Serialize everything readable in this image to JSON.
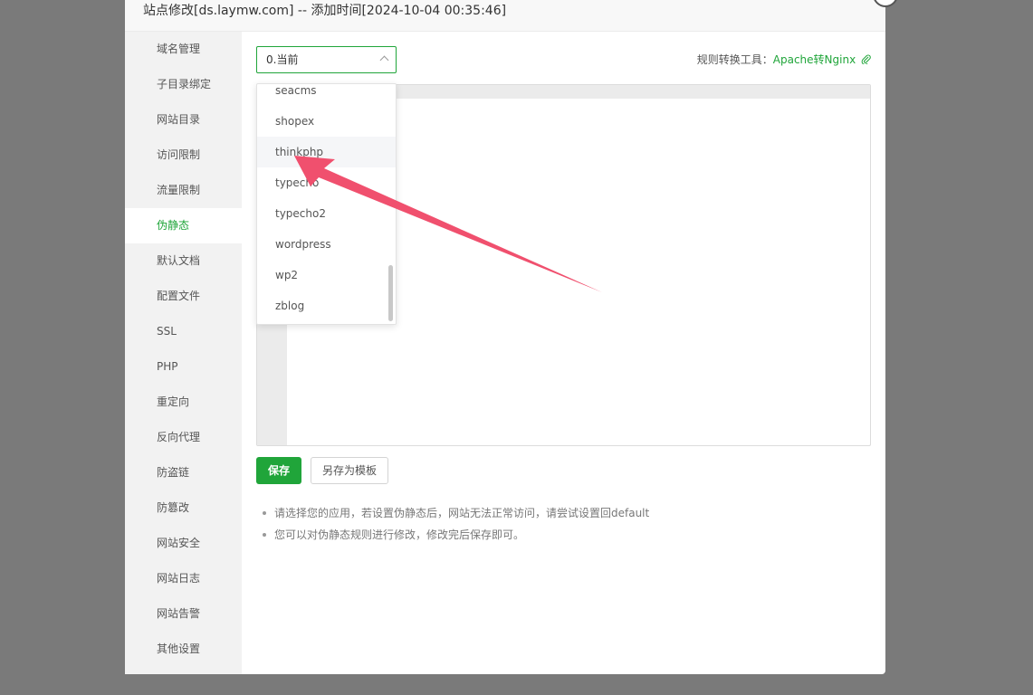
{
  "dialog": {
    "title": "站点修改[ds.laymw.com] -- 添加时间[2024-10-04 00:35:46]",
    "close_icon": "close-icon"
  },
  "sidebar": {
    "items": [
      {
        "label": "域名管理"
      },
      {
        "label": "子目录绑定"
      },
      {
        "label": "网站目录"
      },
      {
        "label": "访问限制"
      },
      {
        "label": "流量限制"
      },
      {
        "label": "伪静态",
        "active": true
      },
      {
        "label": "默认文档"
      },
      {
        "label": "配置文件"
      },
      {
        "label": "SSL"
      },
      {
        "label": "PHP"
      },
      {
        "label": "重定向"
      },
      {
        "label": "反向代理"
      },
      {
        "label": "防盗链"
      },
      {
        "label": "防篡改"
      },
      {
        "label": "网站安全"
      },
      {
        "label": "网站日志"
      },
      {
        "label": "网站告警"
      },
      {
        "label": "其他设置"
      }
    ]
  },
  "rewrite": {
    "selected": "0.当前",
    "tool_label": "规则转换工具：",
    "tool_link": "Apache转Nginx",
    "tool_icon": "paperclip-icon",
    "options": [
      "seacms",
      "shopex",
      "thinkphp",
      "typecho",
      "typecho2",
      "wordpress",
      "wp2",
      "zblog"
    ],
    "hovered_option": "thinkphp",
    "save_label": "保存",
    "save_template_label": "另存为模板"
  },
  "tips": [
    "请选择您的应用，若设置伪静态后，网站无法正常访问，请尝试设置回default",
    "您可以对伪静态规则进行修改，修改完后保存即可。"
  ],
  "colors": {
    "accent": "#20a53a",
    "annotation_arrow": "#f0506e",
    "overlay": "#7a7a7a"
  }
}
